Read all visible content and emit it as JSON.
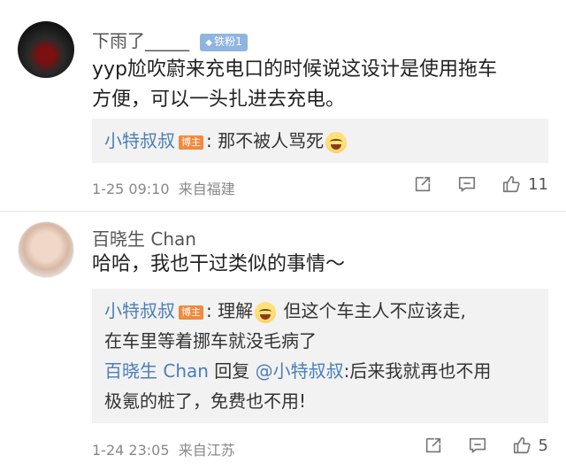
{
  "comments": [
    {
      "username": "下雨了_____",
      "fan_badge": "铁粉1",
      "text_line1": "yyp尬吹蔚来充电口的时候说这设计是使用拖车",
      "text_line2": "方便，可以一头扎进去充电。",
      "replies": [
        {
          "name": "小特叔叔",
          "badge": "博主",
          "text": ": 那不被人骂死"
        }
      ],
      "timestamp": "1-25 09:10",
      "location": "来自福建",
      "likes": "11"
    },
    {
      "username": "百晓生 Chan",
      "text": "哈哈，我也干过类似的事情～",
      "replies": [
        {
          "name": "小特叔叔",
          "badge": "博主",
          "text_a": ": 理解",
          "text_b": " 但这个车主人不应该走,",
          "text_line2": "在车里等着挪车就没毛病了"
        },
        {
          "name": "百晓生 Chan",
          "mid": " 回复 ",
          "target": "@小特叔叔",
          "text": ":后来我就再也不用",
          "text_line2": "极氪的桩了，免费也不用!"
        }
      ],
      "timestamp": "1-24 23:05",
      "location": "来自江苏",
      "likes": "5"
    }
  ],
  "colors": {
    "link": "#4a7eb8",
    "host_badge": "#f08a3e",
    "fan_badge": "#8fb4e0",
    "reply_bg": "#f2f2f2"
  },
  "icons": [
    "share-icon",
    "comment-icon",
    "like-icon",
    "emoji-icon"
  ]
}
